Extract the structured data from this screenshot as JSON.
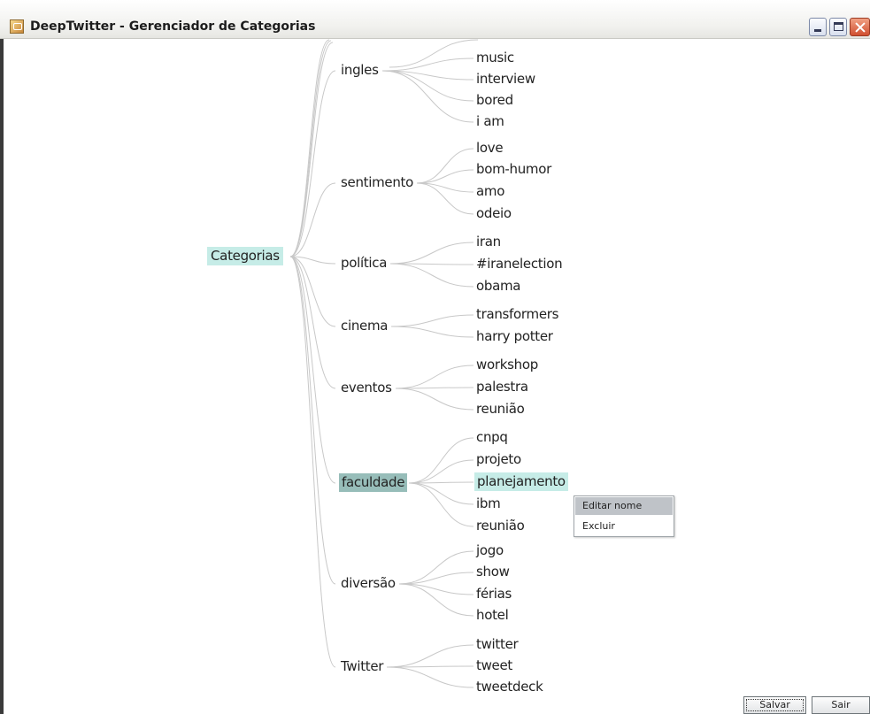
{
  "window": {
    "title": "DeepTwitter - Gerenciador de Categorias"
  },
  "tree": {
    "root": "Categorias",
    "categories": [
      {
        "label": "ingles",
        "children": [
          "music",
          "interview",
          "bored",
          "i am"
        ]
      },
      {
        "label": "sentimento",
        "children": [
          "love",
          "bom-humor",
          "amo",
          "odeio"
        ]
      },
      {
        "label": "política",
        "children": [
          "iran",
          "#iranelection",
          "obama"
        ]
      },
      {
        "label": "cinema",
        "children": [
          "transformers",
          "harry potter"
        ]
      },
      {
        "label": "eventos",
        "children": [
          "workshop",
          "palestra",
          "reunião"
        ]
      },
      {
        "label": "faculdade",
        "children": [
          "cnpq",
          "projeto",
          "planejamento",
          "ibm",
          "reunião"
        ]
      },
      {
        "label": "diversão",
        "children": [
          "jogo",
          "show",
          "férias",
          "hotel"
        ]
      },
      {
        "label": "Twitter",
        "children": [
          "twitter",
          "tweet",
          "tweetdeck"
        ]
      }
    ]
  },
  "context_menu": {
    "items": [
      "Editar nome",
      "Excluir"
    ]
  },
  "buttons": {
    "save": "Salvar",
    "exit": "Sair"
  },
  "colors": {
    "selected_root": "#c6ece7",
    "selected_category": "#97bdb9",
    "hover_leaf": "#c6ece7",
    "tree_lines": "#c8c8c8"
  }
}
